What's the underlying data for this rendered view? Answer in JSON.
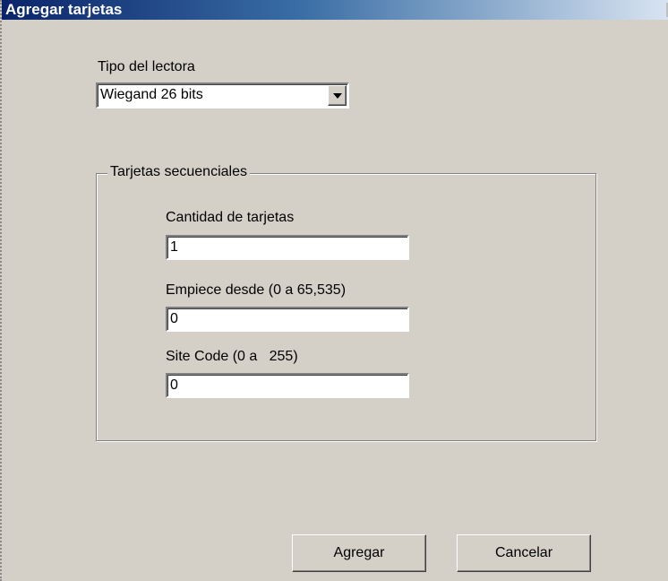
{
  "window": {
    "title": "Agregar tarjetas"
  },
  "reader": {
    "label": "Tipo del lectora",
    "selected": "Wiegand 26 bits"
  },
  "group": {
    "legend": "Tarjetas secuenciales",
    "quantity": {
      "label": "Cantidad de tarjetas",
      "value": "1"
    },
    "start_from": {
      "label": "Empiece desde (0 a 65,535)",
      "value": "0"
    },
    "site_code": {
      "label": "Site Code (0 a   255)",
      "value": "0"
    }
  },
  "buttons": {
    "add": "Agregar",
    "cancel": "Cancelar"
  },
  "colors": {
    "title_start": "#0a246a",
    "title_end": "#d9e4f2",
    "face": "#d4d0c8"
  }
}
